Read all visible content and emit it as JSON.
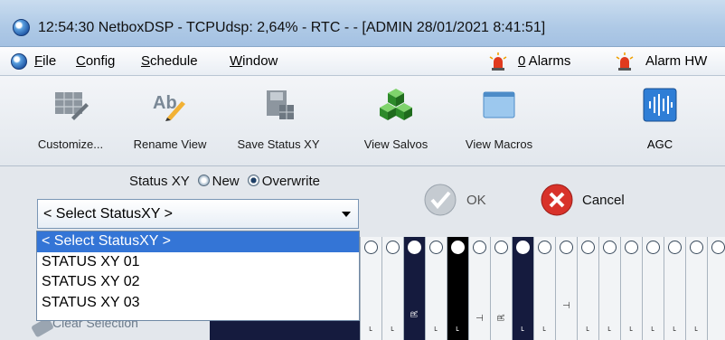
{
  "window": {
    "title": "12:54:30  NetboxDSP - TCPUdsp: 2,64% -  RTC  -  - [ADMIN  28/01/2021 8:41:51]"
  },
  "menubar": {
    "items": [
      {
        "underline": "F",
        "rest": "ile"
      },
      {
        "underline": "C",
        "rest": "onfig"
      },
      {
        "underline": "S",
        "rest": "chedule"
      },
      {
        "underline": "W",
        "rest": "indow"
      }
    ],
    "alarms": {
      "underline": "0",
      "rest": " Alarms"
    },
    "alarm_hw": "Alarm HW"
  },
  "toolbar": {
    "buttons": [
      {
        "label": "Customize...",
        "icon": "table-edit-icon"
      },
      {
        "label": "Rename View",
        "icon": "rename-ab-icon"
      },
      {
        "label": "Save Status XY",
        "icon": "save-status-icon"
      },
      {
        "label": "View Salvos",
        "icon": "salvos-cubes-icon"
      },
      {
        "label": "View Macros",
        "icon": "macros-window-icon"
      },
      {
        "label": "AGC",
        "icon": "agc-waveform-icon"
      }
    ]
  },
  "status_xy": {
    "label": "Status XY",
    "option_new": "New",
    "option_overwrite": "Overwrite",
    "selected_option": "Overwrite"
  },
  "select": {
    "value": "< Select StatusXY >",
    "options": [
      "< Select StatusXY >",
      "STATUS XY 01",
      "STATUS XY 02",
      "STATUS XY 03"
    ]
  },
  "actions": {
    "ok": "OK",
    "cancel": "Cancel"
  },
  "clear_selection": "Clear Selection",
  "colors": {
    "selected_item": "#3475d6",
    "title_bar": "#aec9e6",
    "strip_dark": "#151b3e"
  }
}
